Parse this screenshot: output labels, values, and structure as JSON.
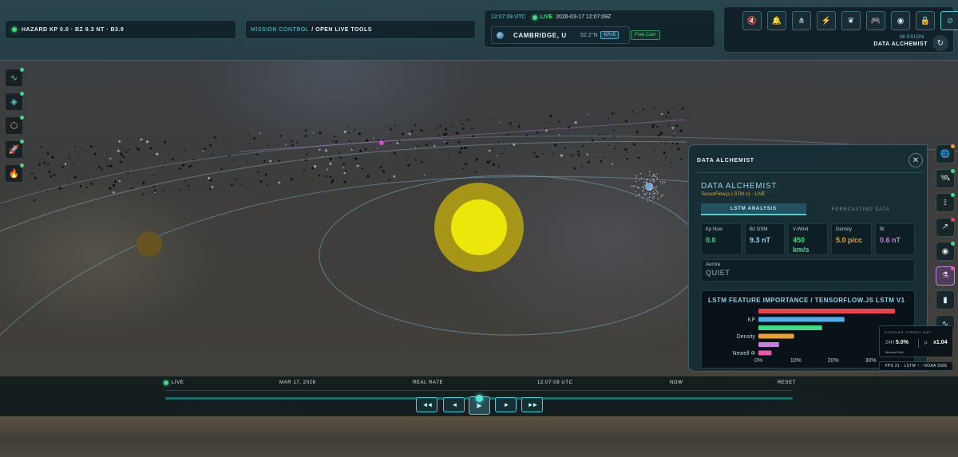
{
  "topbar": {
    "hazard_text": "HAZARD KP 0.0 · BZ 9.3 NT · B3.9",
    "mission_control_label": "MISSION CONTROL",
    "mission_control_link": "/ OPEN LIVE TOOLS",
    "utc_time": "12:07:09 UTC",
    "live_label": "LIVE",
    "live_timestamp": "2026-03-17 12:07:09Z",
    "location_city": "CAMBRIDGE, U",
    "location_lat": "52.2°N",
    "kp_badge": "KP≥5",
    "free_cam": "Free Cam",
    "tools": [
      {
        "icon": "mute-icon",
        "glyph": "🔇"
      },
      {
        "icon": "bell-icon",
        "glyph": "🔔"
      },
      {
        "icon": "share-icon",
        "glyph": "⋔"
      },
      {
        "icon": "lightning-icon",
        "glyph": "⚡"
      },
      {
        "icon": "leaf-icon",
        "glyph": "❦"
      },
      {
        "icon": "gamepad-icon",
        "glyph": "🎮"
      },
      {
        "icon": "broadcast-icon",
        "glyph": "◉"
      },
      {
        "icon": "lock-icon",
        "glyph": "🔒"
      },
      {
        "icon": "compass-icon",
        "glyph": "⊘"
      }
    ],
    "mission_label": "MISSION",
    "mission_name": "DATA ALCHEMIST",
    "refresh_glyph": "↻"
  },
  "left_toolbar": [
    {
      "icon": "pulse-icon",
      "glyph": "∿",
      "color": "#4fd0d9"
    },
    {
      "icon": "layers-icon",
      "glyph": "◈",
      "color": "#4fd0d9"
    },
    {
      "icon": "shield-icon",
      "glyph": "⬡",
      "color": "#e0b43b"
    },
    {
      "icon": "rocket-icon",
      "glyph": "🚀",
      "color": "#e0b43b"
    },
    {
      "icon": "flame-icon",
      "glyph": "🔥",
      "color": "#e07b3b"
    }
  ],
  "panel": {
    "header": "DATA ALCHEMIST",
    "close_glyph": "✕",
    "title": "DATA ALCHEMIST",
    "subtitle": "TensorFlow.js LSTM v1 · LIVE",
    "tab_active": "LSTM ANALYSIS",
    "tab_inactive": "FORECASTING DATA",
    "metrics": [
      {
        "label": "Kp Now",
        "value": "0.0",
        "color": "#3ddc84"
      },
      {
        "label": "Bz GSM",
        "value": "9.3 nT",
        "color": "#8fd2f0"
      },
      {
        "label": "V-Wind",
        "value": "450 km/s",
        "color": "#3ddc84"
      },
      {
        "label": "Density",
        "value": "5.0 p/cc",
        "color": "#f0a030"
      },
      {
        "label": "Bt",
        "value": "0.6 nT",
        "color": "#c77ddb"
      }
    ],
    "aurora_label": "Aurora",
    "aurora_value": "QUIET"
  },
  "chart_data": {
    "type": "bar",
    "orientation": "horizontal",
    "title": "LSTM FEATURE IMPORTANCE / TENSORFLOW.JS LSTM V1",
    "categories": [
      "",
      "KP",
      "",
      "Density",
      "",
      "Newell Φ"
    ],
    "values": [
      36.5,
      23.0,
      17.0,
      9.5,
      5.5,
      3.5
    ],
    "colors": [
      "#e8454f",
      "#4fb0e8",
      "#3ddc84",
      "#f0a030",
      "#c77ddb",
      "#e85ba8"
    ],
    "x_ticks": [
      "0%",
      "10%",
      "20%",
      "30%"
    ],
    "xlim": [
      0,
      35
    ],
    "grid": false
  },
  "right_toolbar": [
    {
      "icon": "globe-icon",
      "glyph": "🌐",
      "dot": "#f0a030"
    },
    {
      "icon": "satellite-icon",
      "glyph": "🛰",
      "dot": "#3ddc84"
    },
    {
      "icon": "rss-icon",
      "glyph": "⟟",
      "dot": "#3ddc84"
    },
    {
      "icon": "trend-icon",
      "glyph": "↗",
      "dot": "#e8454f"
    },
    {
      "icon": "radio-icon",
      "glyph": "◉",
      "dot": "#3ddc84"
    },
    {
      "icon": "flask-icon",
      "glyph": "⚗",
      "dot": "#e85ba8"
    },
    {
      "icon": "bar-chart-icon",
      "glyph": "▮",
      "dot": ""
    },
    {
      "icon": "activity-icon",
      "glyph": "∿",
      "dot": ""
    }
  ],
  "kessler": {
    "title": "KESSLER THREAT NET",
    "label_24h": "24H",
    "value_24h": "5.0%",
    "mu_label": "μ",
    "multiplier": "x1.04",
    "risk": "Minimal Risk"
  },
  "fps_line": "FPS 21 · LSTM ~ · NOAA 3365",
  "timeline": {
    "live": "LIVE",
    "date": "MAR 17, 2026",
    "rate": "REAL RATE",
    "time": "12:07:08 UTC",
    "now": "NOW",
    "reset": "RESET",
    "controls": {
      "rewind_fast": "◄◄",
      "rewind": "◄",
      "play": "▶",
      "forward": "►",
      "forward_fast": "►►"
    }
  }
}
